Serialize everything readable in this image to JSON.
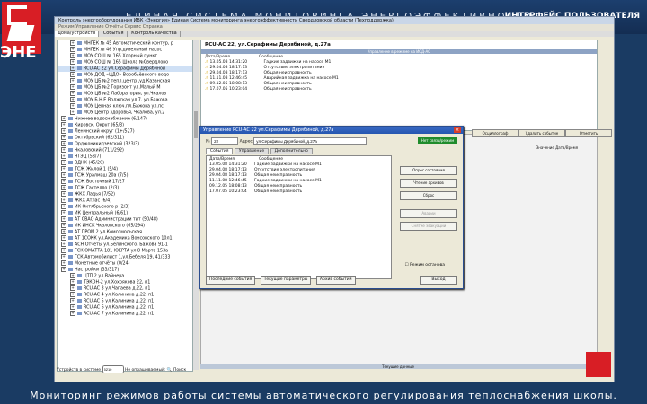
{
  "banner": {
    "title": "ЕДИНАЯ СИСТЕМА МОНИТОРИНГА ЭНЕРГОЭФФЕКТИВНОСТИ",
    "right": "ИНТЕРФЕЙС ПОЛЬЗОВАТЕЛЯ",
    "side_letters": "ЭНЕ"
  },
  "app": {
    "title": "Контроль энергооборудования  ИВК «Энергия»  Единая Система мониторинга энергоэффективности Свердловской области (Техподдержка)",
    "menu": "Режим   Управление   Отчёты   Сервис   Справка",
    "tabs": [
      "Дома/устройств",
      "События",
      "Контроль качества"
    ],
    "tree": [
      "МНГЕК № 45 Автоматический контур, р",
      "МНГЕК № 46 Упр.дизельный насос",
      "МОУ СОШ № 165 Хлорный пункт ",
      "МОУ СОШ № 165  Школа №Свердлово",
      "RCU-AC 22 ул.Серафимы Дерябиной",
      "МОУ ДОД «ЦДО» Воробьёвского водо",
      "МОУ ЦБ №2 тепл.центр ,уд.Казанская",
      "МОУ ЦБ №2 Горизонт ул.Малый М",
      "МОУ ЦБ №2 Лаборатория, ул.Чкалов",
      "МОУ Б.Н.Е Волжская ул 7, ул.Бажова",
      "МОУ Цепная ключ.пл.Бажова ул.пс",
      "МОУ Центр здоровья, Чкалова, ул.2",
      "Нижнее водоснабжение (6/147)",
      "Кировск. Округ (65/3)",
      "Ленинский округ (1+/527)",
      "Октябрьский (62/311)",
      "Орджоникидзевский (323/3)",
      "Чкаловский (711/292)",
      "ЧТЭЦ (58/7)",
      "ВДНХ (45/20)",
      "ТСЖ Жилой 1 (5/4)",
      "ТСЖ Уралмаш 20а (7/5)",
      "ТСЖ Восточный 17/27",
      "ТСЖ Гастелло (2/3)",
      "ЖКХ Ладья (7/52)",
      "ЖКХ Атлас (6/4)",
      "ИК Октябрьского р (2/3)",
      "ИК Центральный (6/61)",
      "АТ СВАО Администрации тит (50/48)",
      "ИК ИНСК Чкаловского (65/294)",
      "АТ ПРОМ 2 ул.Комсомольская",
      "АТ 1СОКК ул.Академика Вонсовского 10л1",
      "АСН Отчеты ул.Белинского,  Бажова 91-1",
      "ГСК ОМАТТА 181 ЮЕРТА ул.8 Марта 153а",
      "ГСК  Автомобилист 1,ул.Бебеля 19,  41/333",
      "Монетные отчёты (0/24)",
      "Настройки (33/317)",
      "ЦТП 2 ул.Вайнера",
      "ТЭКОН-2 ул.Хохрякова 22, п1",
      "RCU-AC 3 ул.Чапаева д.22, п1",
      "RCU-AC 4 ул.Калинина д.22, п1",
      "RCU-AC 5 ул.Калинина д.22, п1",
      "RCU-AC 6 ул.Калинина д.22, п1",
      "RCU-AC 7 ул.Калинина д.22, п1"
    ],
    "main_title": "RCU-AC 22, ул.Серафимы Дерябиной, д.27а",
    "strip_text": "Управление в режиме на ИСД-АС",
    "grid_headers": [
      "Дата/Время",
      "Сообщение"
    ],
    "events": [
      [
        "13.05.08 14:31:20",
        "Гадкие задвижки на насосе М1"
      ],
      [
        "29.04.08 18:17:13",
        "Отсутствие электропитания"
      ],
      [
        "29.04.08 18:17:13",
        "Общая неисправность"
      ],
      [
        "11.11.08 12:46:45",
        "Аварийная задвижка на насосе М1"
      ],
      [
        "09.12.05 18:08:13",
        "Общая неисправность"
      ],
      [
        "17.07.05 10:23:04",
        "Общая неисправность"
      ]
    ],
    "right_buttons": [
      "Осциллограф",
      "Удалить событие",
      "Отметить"
    ],
    "right_col_head": "Значение   Дата/Время",
    "status": {
      "label": "Устройств  в системе",
      "count": "5210",
      "not_working": "Не опрашиваемый:",
      "search": "Поиск"
    },
    "bottom_strip": "Текущие данные"
  },
  "dialog": {
    "title": "Управление  RCU-AC 22 ул.Серафимы Дерябиной, д.27а",
    "num_label": "№",
    "num_value": "22",
    "addr_label": "Адрес",
    "addr_value": "ул.Серафимы Дерябиной, д.27а",
    "status_button": "Нет связи/режим",
    "tabs": [
      "События",
      "Управление",
      "Дополнительно"
    ],
    "list_headers": [
      "Дата/Время",
      "Сообщение"
    ],
    "rows": [
      [
        "13.05.08 14:31:20",
        "Гадкие задвижки на насосе М1"
      ],
      [
        "29.04.08 18:17:13",
        "Отсутствие электропитания"
      ],
      [
        "29.04.08 18:17:13",
        "Общая неисправность"
      ],
      [
        "11.11.08 12:46:45",
        "Гадкие задвижки на насосе М1"
      ],
      [
        "09.12.05 18:08:13",
        "Общая неисправность"
      ],
      [
        "17.07.05 10:23:04",
        "Общая неисправность"
      ]
    ],
    "buttons": [
      "Опрос состояния",
      "Чтение архивов",
      "Сброс",
      "Аварии",
      "Снятие эвакуации"
    ],
    "checkbox": "Режим  останова",
    "bottom_buttons": [
      "Последние события",
      "Текущие параметры",
      "Архив  событий"
    ],
    "exit": "Выход"
  },
  "caption": "Мониторинг режимов работы системы автоматического регулирования теплоснабжения школы.",
  "colors": {
    "banner": "#1c3f6e",
    "logo": "#d81e25",
    "status_green": "#1f8c2c"
  }
}
